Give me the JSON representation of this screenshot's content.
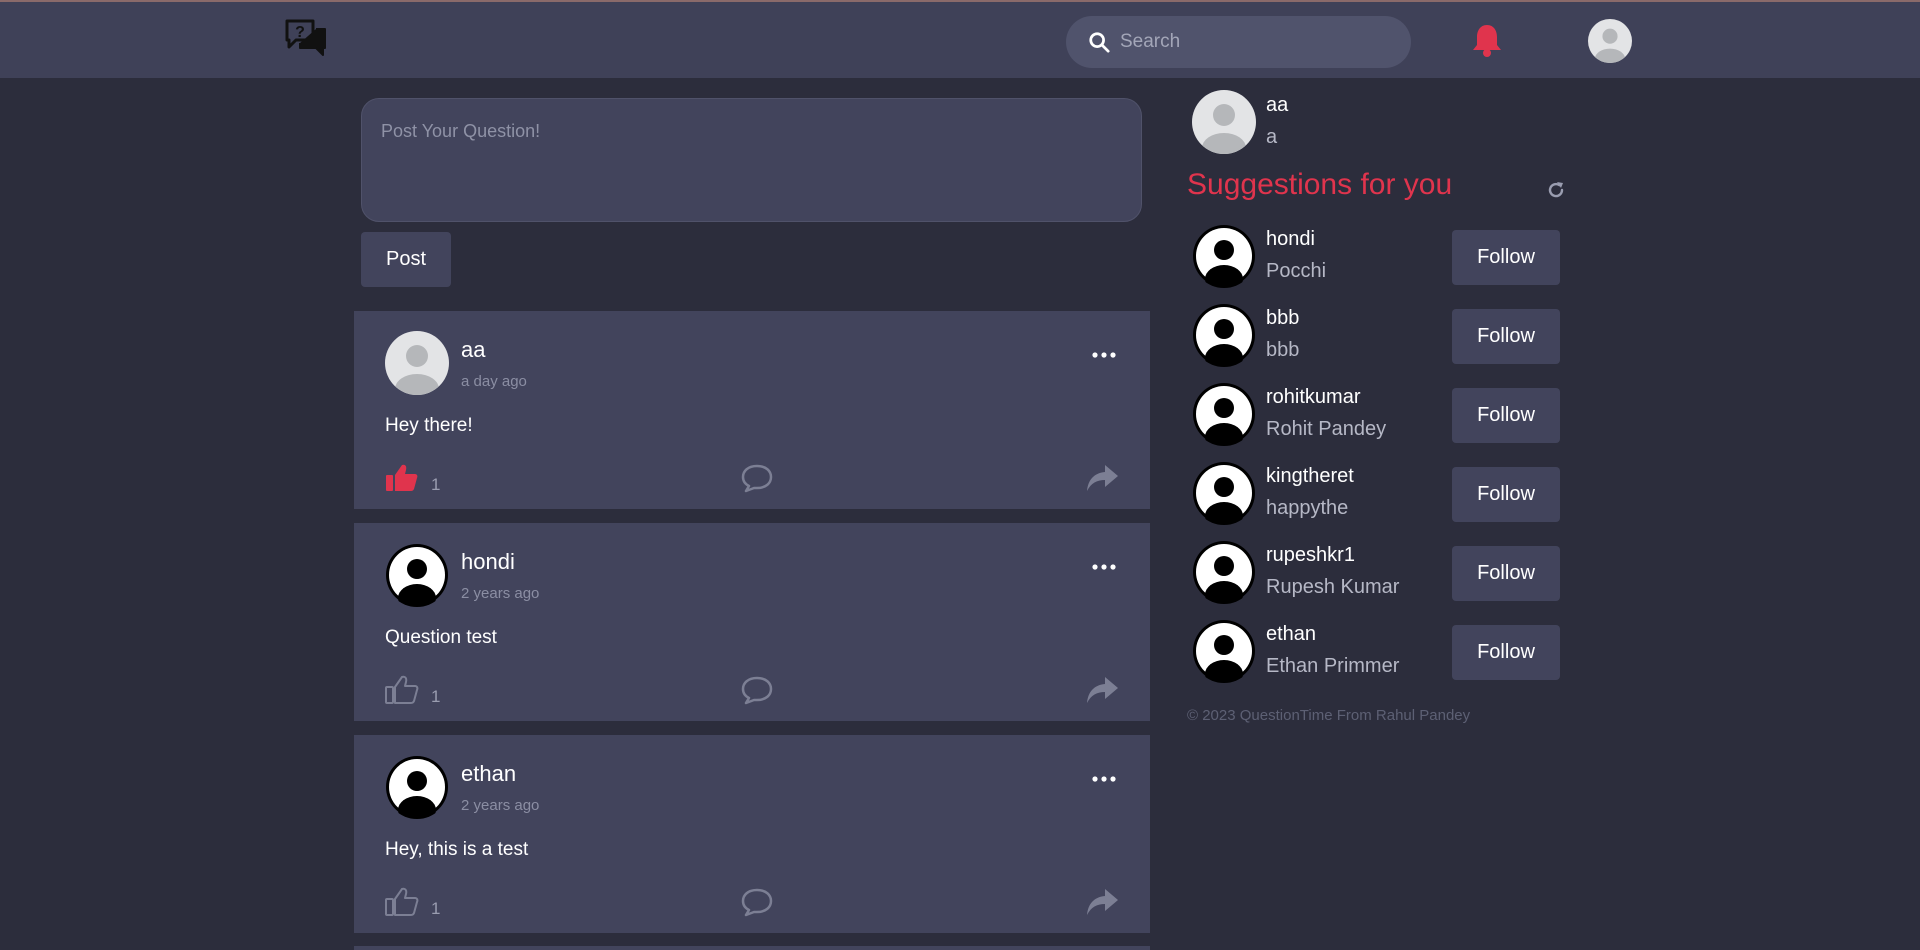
{
  "header": {
    "logo_icon": "question-chat-icon",
    "search": {
      "placeholder": "Search",
      "value": ""
    },
    "notification_icon": "bell-icon",
    "accent_color": "#e0344d"
  },
  "composer": {
    "placeholder": "Post Your Question!",
    "post_label": "Post"
  },
  "posts": [
    {
      "author": "aa",
      "time": "a day ago",
      "text": "Hey there!",
      "likes": "1",
      "liked": true
    },
    {
      "author": "hondi",
      "time": "2 years ago",
      "text": "Question test",
      "likes": "1",
      "liked": false
    },
    {
      "author": "ethan",
      "time": "2 years ago",
      "text": "Hey, this is a test",
      "likes": "1",
      "liked": false
    }
  ],
  "sidebar": {
    "profile": {
      "name": "aa",
      "handle": "a"
    },
    "suggestions_title": "Suggestions for you",
    "follow_label": "Follow",
    "suggestions": [
      {
        "username": "hondi",
        "name": "Pocchi"
      },
      {
        "username": "bbb",
        "name": "bbb"
      },
      {
        "username": "rohitkumar",
        "name": "Rohit Pandey"
      },
      {
        "username": "kingtheret",
        "name": "happythe"
      },
      {
        "username": "rupeshkr1",
        "name": "Rupesh Kumar"
      },
      {
        "username": "ethan",
        "name": "Ethan Primmer"
      }
    ],
    "footer": "© 2023 QuestionTime From Rahul Pandey"
  }
}
